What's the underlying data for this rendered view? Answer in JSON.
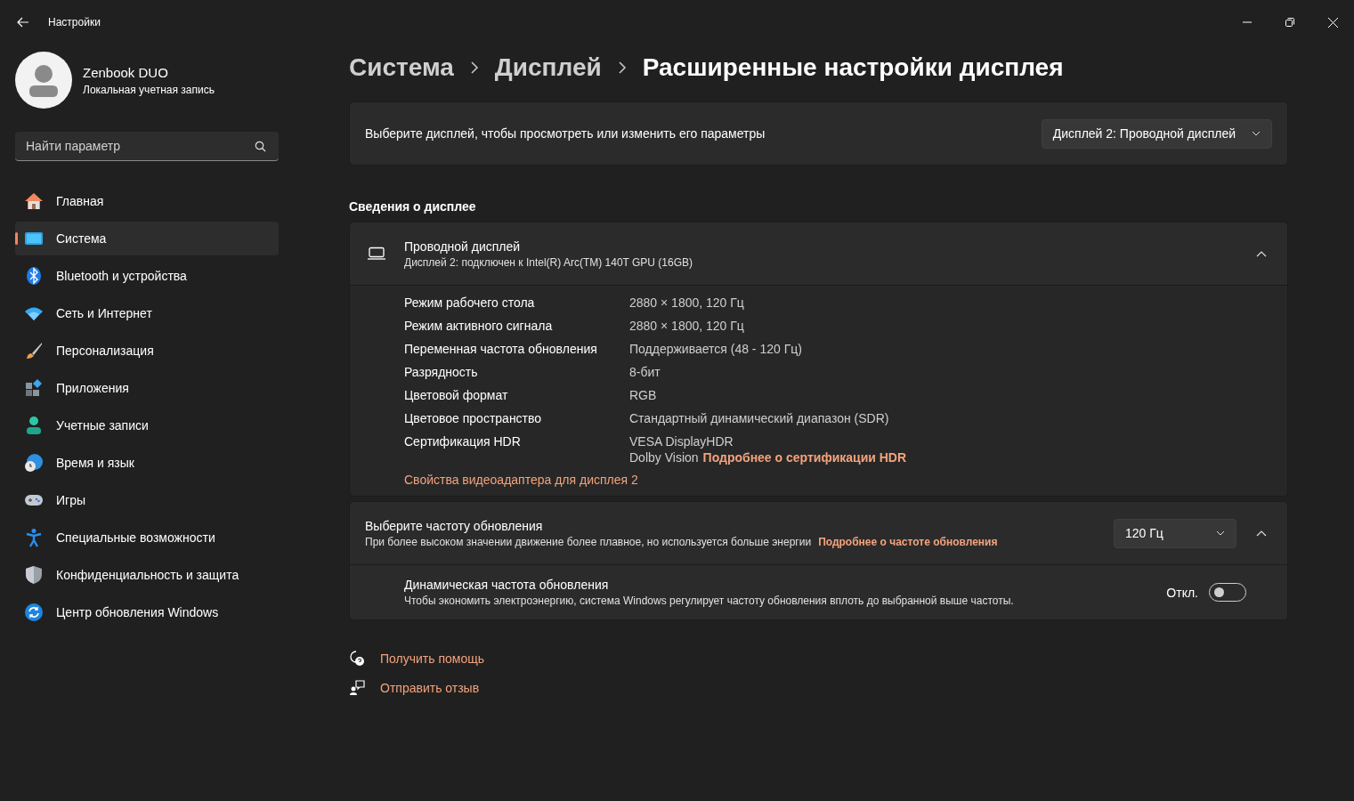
{
  "window": {
    "title": "Настройки"
  },
  "account": {
    "name": "Zenbook DUO",
    "type": "Локальная учетная запись"
  },
  "search": {
    "placeholder": "Найти параметр"
  },
  "nav": [
    {
      "kind": "home",
      "label": "Главная",
      "selected": false
    },
    {
      "kind": "system",
      "label": "Система",
      "selected": true
    },
    {
      "kind": "bluetooth",
      "label": "Bluetooth и устройства",
      "selected": false
    },
    {
      "kind": "network",
      "label": "Сеть и Интернет",
      "selected": false
    },
    {
      "kind": "brush",
      "label": "Персонализация",
      "selected": false
    },
    {
      "kind": "apps",
      "label": "Приложения",
      "selected": false
    },
    {
      "kind": "accounts",
      "label": "Учетные записи",
      "selected": false
    },
    {
      "kind": "time",
      "label": "Время и язык",
      "selected": false
    },
    {
      "kind": "games",
      "label": "Игры",
      "selected": false
    },
    {
      "kind": "access",
      "label": "Специальные возможности",
      "selected": false
    },
    {
      "kind": "privacy",
      "label": "Конфиденциальность и защита",
      "selected": false
    },
    {
      "kind": "update",
      "label": "Центр обновления Windows",
      "selected": false
    }
  ],
  "breadcrumb": [
    "Система",
    "Дисплей",
    "Расширенные настройки дисплея"
  ],
  "display_select": {
    "label": "Выберите дисплей, чтобы просмотреть или изменить его параметры",
    "value": "Дисплей 2: Проводной дисплей"
  },
  "section_title": "Сведения о дисплее",
  "display_info": {
    "title": "Проводной дисплей",
    "subtitle": "Дисплей 2: подключен к Intel(R) Arc(TM) 140T GPU (16GB)",
    "expanded": true,
    "rows": [
      {
        "label": "Режим рабочего стола",
        "lines": [
          "2880 × 1800, 120 Гц"
        ]
      },
      {
        "label": "Режим активного сигнала",
        "lines": [
          "2880 × 1800, 120 Гц"
        ]
      },
      {
        "label": "Переменная частота обновления",
        "lines": [
          "Поддерживается (48 - 120 Гц)"
        ]
      },
      {
        "label": "Разрядность",
        "lines": [
          "8-бит"
        ]
      },
      {
        "label": "Цветовой формат",
        "lines": [
          "RGB"
        ]
      },
      {
        "label": "Цветовое пространство",
        "lines": [
          "Стандартный динамический диапазон (SDR)"
        ]
      },
      {
        "label": "Сертификация HDR",
        "lines": [
          "VESA DisplayHDR",
          "Dolby Vision"
        ],
        "link": "Подробнее о сертификации HDR"
      }
    ],
    "adapter_link": "Свойства видеоадаптера для дисплея 2"
  },
  "refresh": {
    "title": "Выберите частоту обновления",
    "description": "При более высоком значении движение более плавное, но используется больше энергии",
    "link": "Подробнее о частоте обновления",
    "value": "120 Гц",
    "expanded": true,
    "dynamic": {
      "title": "Динамическая частота обновления",
      "description": "Чтобы экономить электроэнергию, система Windows регулирует частоту обновления вплоть до выбранной выше частоты.",
      "state_label": "Откл.",
      "on": false
    }
  },
  "footer_links": [
    {
      "kind": "help",
      "label": "Получить помощь"
    },
    {
      "kind": "feedback",
      "label": "Отправить отзыв"
    }
  ]
}
